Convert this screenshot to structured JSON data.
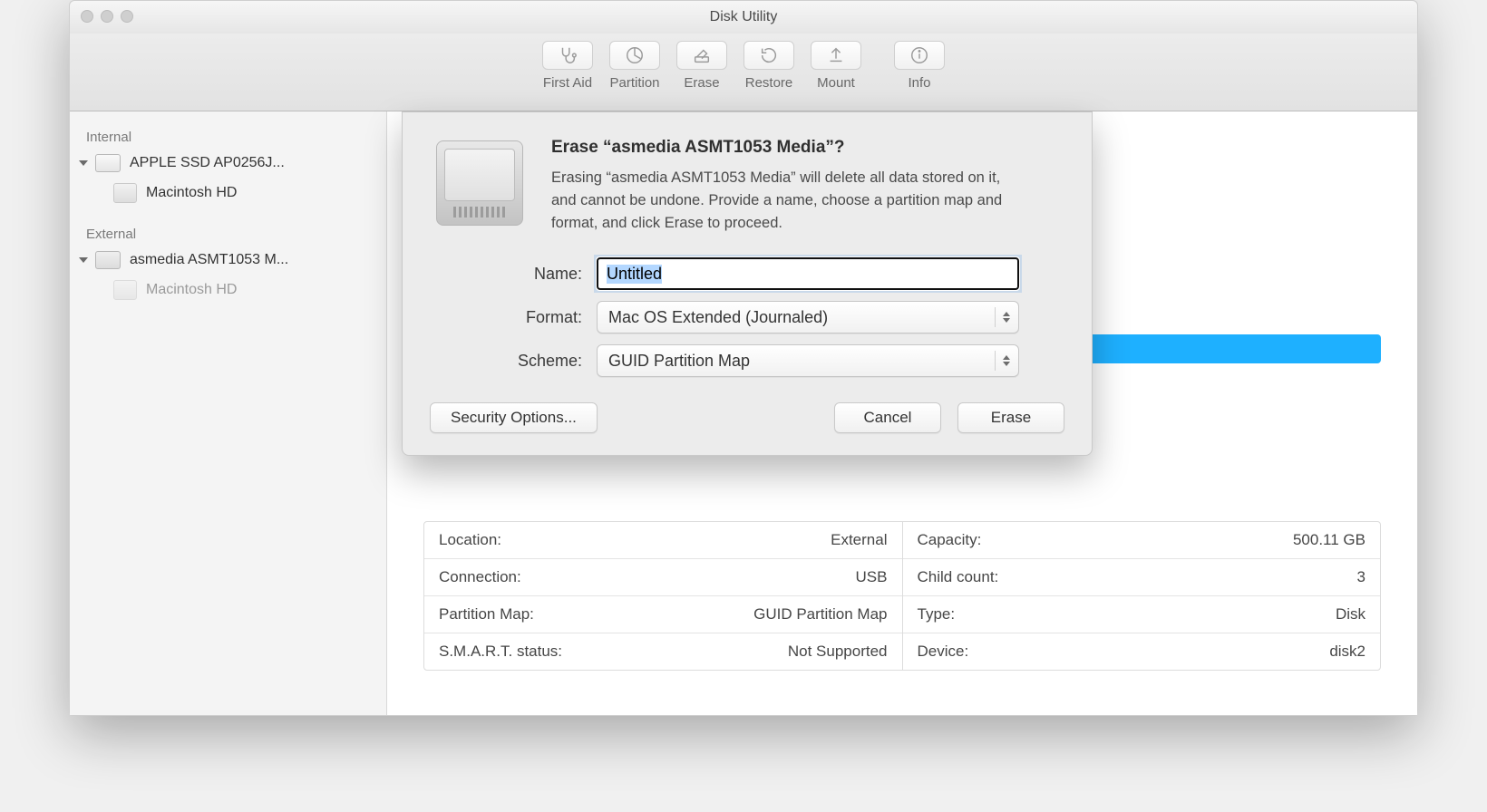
{
  "window": {
    "title": "Disk Utility"
  },
  "toolbar": {
    "first_aid": "First Aid",
    "partition": "Partition",
    "erase": "Erase",
    "restore": "Restore",
    "mount": "Mount",
    "info": "Info"
  },
  "sidebar": {
    "internal_header": "Internal",
    "external_header": "External",
    "internal_disk": "APPLE SSD AP0256J...",
    "internal_vol": "Macintosh HD",
    "external_disk": "asmedia ASMT1053 M...",
    "external_vol": "Macintosh HD"
  },
  "dialog": {
    "title": "Erase “asmedia ASMT1053 Media”?",
    "description": "Erasing “asmedia ASMT1053 Media” will delete all data stored on it, and cannot be undone. Provide a name, choose a partition map and format, and click Erase to proceed.",
    "name_label": "Name:",
    "name_value": "Untitled",
    "format_label": "Format:",
    "format_value": "Mac OS Extended (Journaled)",
    "scheme_label": "Scheme:",
    "scheme_value": "GUID Partition Map",
    "security_options": "Security Options...",
    "cancel": "Cancel",
    "erase": "Erase"
  },
  "details": {
    "left": [
      {
        "k": "Location:",
        "v": "External"
      },
      {
        "k": "Connection:",
        "v": "USB"
      },
      {
        "k": "Partition Map:",
        "v": "GUID Partition Map"
      },
      {
        "k": "S.M.A.R.T. status:",
        "v": "Not Supported"
      }
    ],
    "right": [
      {
        "k": "Capacity:",
        "v": "500.11 GB"
      },
      {
        "k": "Child count:",
        "v": "3"
      },
      {
        "k": "Type:",
        "v": "Disk"
      },
      {
        "k": "Device:",
        "v": "disk2"
      }
    ]
  }
}
